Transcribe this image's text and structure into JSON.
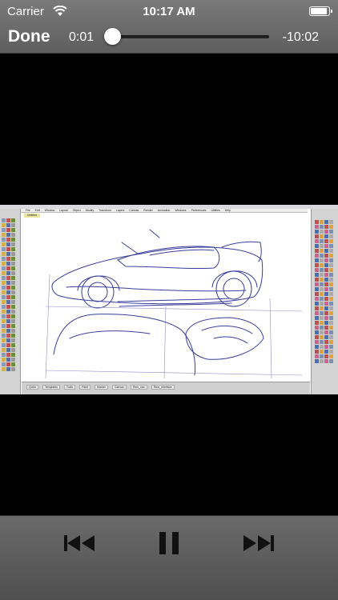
{
  "status_bar": {
    "carrier": "Carrier",
    "time": "10:17 AM",
    "battery_level": 0.95,
    "wifi_icon": "wifi-icon"
  },
  "player": {
    "done_label": "Done",
    "elapsed": "0:01",
    "remaining": "-10:02",
    "progress": 0.002
  },
  "video_frame": {
    "app_menu": [
      "File",
      "Edit",
      "Window",
      "Layout",
      "Object",
      "Modify",
      "Transform",
      "Layers",
      "Canvas",
      "Render",
      "Animation",
      "Windows",
      "Preferences",
      "Utilities",
      "Help"
    ],
    "active_tab": "Untitled",
    "bottom_tabs": [
      "Quick",
      "Templates",
      "Tools",
      "Paint",
      "Marker",
      "Canvas",
      "Rem_nav",
      "Rem_interface"
    ]
  },
  "controls": {
    "prev_icon": "previous-track-icon",
    "pause_icon": "pause-icon",
    "next_icon": "next-track-icon"
  }
}
